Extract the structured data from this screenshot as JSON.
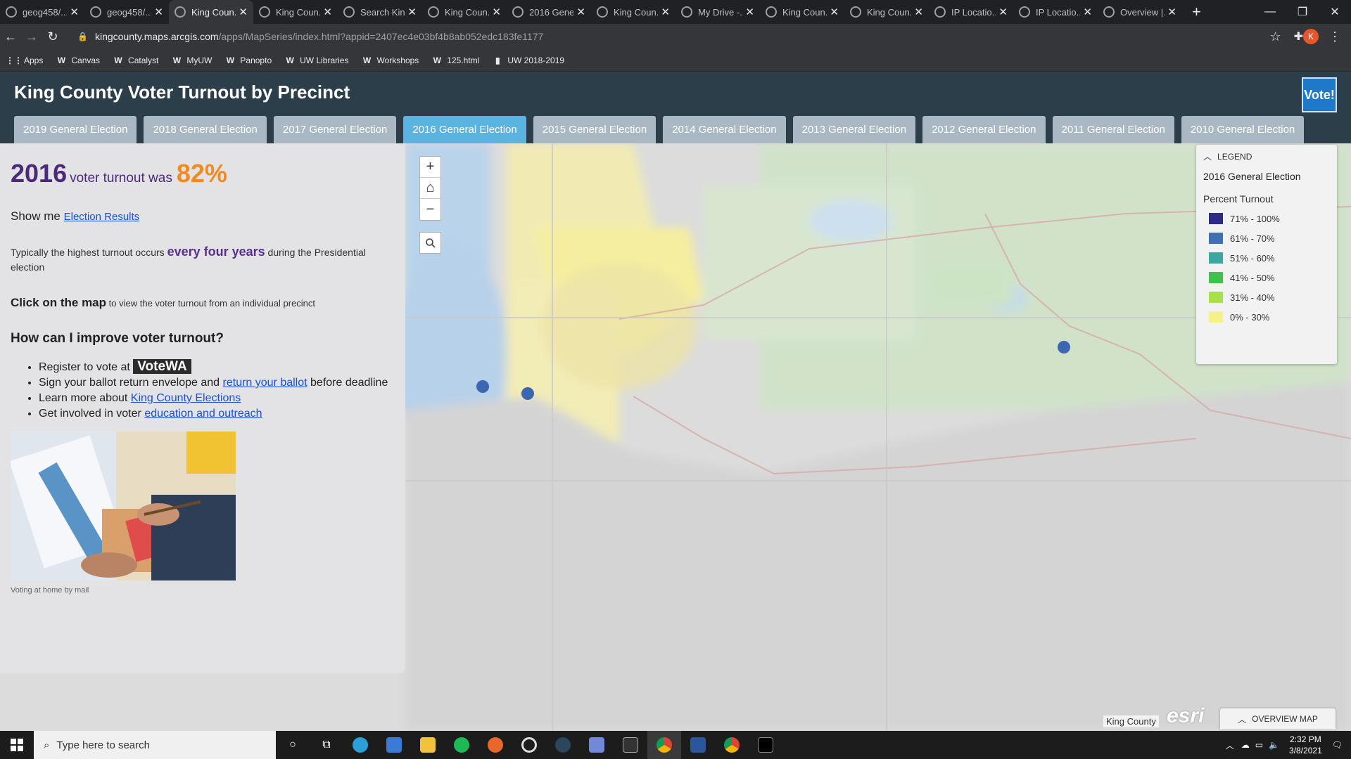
{
  "browser": {
    "tabs": [
      {
        "title": "geog458/..."
      },
      {
        "title": "geog458/..."
      },
      {
        "title": "King Coun...",
        "active": true
      },
      {
        "title": "King Coun..."
      },
      {
        "title": "Search Kin..."
      },
      {
        "title": "King Coun..."
      },
      {
        "title": "2016 Gene..."
      },
      {
        "title": "King Coun..."
      },
      {
        "title": "My Drive -..."
      },
      {
        "title": "King Coun..."
      },
      {
        "title": "King Coun..."
      },
      {
        "title": "IP Locatio..."
      },
      {
        "title": "IP Locatio..."
      },
      {
        "title": "Overview |..."
      }
    ],
    "url_host": "kingcounty.maps.arcgis.com",
    "url_rest": "/apps/MapSeries/index.html?appid=2407ec4e03bf4b8ab052edc183fe1177",
    "profile_initial": "K",
    "bookmarks": [
      "Apps",
      "Canvas",
      "Catalyst",
      "MyUW",
      "Panopto",
      "UW Libraries",
      "Workshops",
      "125.html",
      "UW 2018-2019"
    ]
  },
  "app": {
    "title": "King County Voter Turnout by Precinct",
    "logo_text": "Vote!",
    "election_tabs": [
      "2019 General Election",
      "2018 General Election",
      "2017 General Election",
      "2016 General Election",
      "2015 General Election",
      "2014 General Election",
      "2013 General Election",
      "2012 General Election",
      "2011 General Election",
      "2010 General Election"
    ],
    "active_tab_index": 3
  },
  "panel": {
    "year": "2016",
    "turnout_text": "voter turnout was",
    "turnout_pct": "82%",
    "show_me": "Show me",
    "election_results_link": "Election Results",
    "typical_pre": "Typically the highest turnout occurs",
    "typical_emph": "every four years",
    "typical_post": "during the Presidential election",
    "click_bold": "Click on the map",
    "click_rest": "to view the voter turnout from an individual precinct",
    "improve_heading": "How can I improve voter turnout?",
    "bullet1_pre": "Register to vote at",
    "bullet1_logo": "VoteWA",
    "bullet2_pre": "Sign your ballot return envelope and",
    "bullet2_link": "return your ballot",
    "bullet2_post": "before deadline",
    "bullet3_pre": "Learn more about",
    "bullet3_link": "King County Elections",
    "bullet4_pre": "Get involved in voter",
    "bullet4_link": "education and outreach",
    "caption": "Voting at home by mail"
  },
  "legend": {
    "header": "LEGEND",
    "subtitle": "2016 General Election",
    "field": "Percent Turnout",
    "classes": [
      {
        "label": "71% - 100%",
        "color": "#2e2a8a"
      },
      {
        "label": "61% - 70%",
        "color": "#3f6fb4"
      },
      {
        "label": "51% - 60%",
        "color": "#3aa8a0"
      },
      {
        "label": "41% - 50%",
        "color": "#3fc24a"
      },
      {
        "label": "31% - 40%",
        "color": "#a8e04a"
      },
      {
        "label": "0% - 30%",
        "color": "#f4f08a"
      }
    ]
  },
  "map": {
    "attribution": "King County",
    "esri": "esri",
    "overview_label": "OVERVIEW MAP"
  },
  "taskbar": {
    "search_placeholder": "Type here to search",
    "time": "2:32 PM",
    "date": "3/8/2021"
  }
}
